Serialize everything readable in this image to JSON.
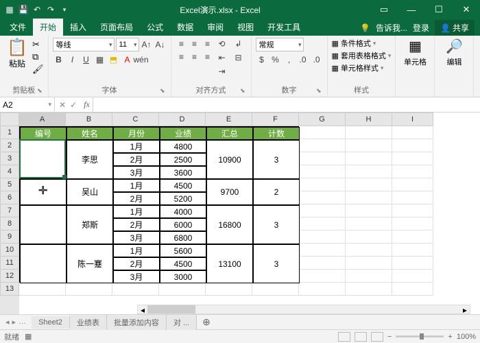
{
  "title": "Excel演示.xlsx - Excel",
  "tabs": {
    "file": "文件",
    "home": "开始",
    "insert": "插入",
    "layout": "页面布局",
    "formulas": "公式",
    "data": "数据",
    "review": "审阅",
    "view": "视图",
    "dev": "开发工具",
    "tellme": "告诉我...",
    "signin": "登录",
    "share": "共享"
  },
  "ribbon": {
    "clipboard": {
      "paste": "粘贴",
      "label": "剪贴板"
    },
    "font": {
      "name": "等线",
      "size": "11",
      "label": "字体"
    },
    "align": {
      "label": "对齐方式"
    },
    "number": {
      "format": "常规",
      "label": "数字"
    },
    "styles": {
      "cond": "条件格式",
      "tbl": "套用表格格式",
      "cell": "单元格样式",
      "label": "样式"
    },
    "cells": {
      "label": "单元格"
    },
    "editing": {
      "label": "编辑"
    }
  },
  "namebox": "A2",
  "columns": [
    "A",
    "B",
    "C",
    "D",
    "E",
    "F",
    "G",
    "H",
    "I"
  ],
  "rows": [
    "1",
    "2",
    "3",
    "4",
    "5",
    "6",
    "7",
    "8",
    "9",
    "10",
    "11",
    "12",
    "13"
  ],
  "headers": {
    "id": "编号",
    "name": "姓名",
    "month": "月份",
    "perf": "业绩",
    "sum": "汇总",
    "count": "计数"
  },
  "people": [
    {
      "name": "李思",
      "rows": [
        {
          "m": "1月",
          "v": "4800"
        },
        {
          "m": "2月",
          "v": "2500"
        },
        {
          "m": "3月",
          "v": "3600"
        }
      ],
      "sum": "10900",
      "count": "3"
    },
    {
      "name": "吴山",
      "rows": [
        {
          "m": "1月",
          "v": "4500"
        },
        {
          "m": "2月",
          "v": "5200"
        }
      ],
      "sum": "9700",
      "count": "2"
    },
    {
      "name": "郑斯",
      "rows": [
        {
          "m": "1月",
          "v": "4000"
        },
        {
          "m": "2月",
          "v": "6000"
        },
        {
          "m": "3月",
          "v": "6800"
        }
      ],
      "sum": "16800",
      "count": "3"
    },
    {
      "name": "陈一蹇",
      "rows": [
        {
          "m": "1月",
          "v": "5600"
        },
        {
          "m": "2月",
          "v": "4500"
        },
        {
          "m": "3月",
          "v": "3000"
        }
      ],
      "sum": "13100",
      "count": "3"
    }
  ],
  "sheets": {
    "s1": "Sheet2",
    "s2": "业绩表",
    "s3": "批量添加内容",
    "s4": "对 ..."
  },
  "status": {
    "ready": "就绪",
    "zoom": "100%"
  }
}
